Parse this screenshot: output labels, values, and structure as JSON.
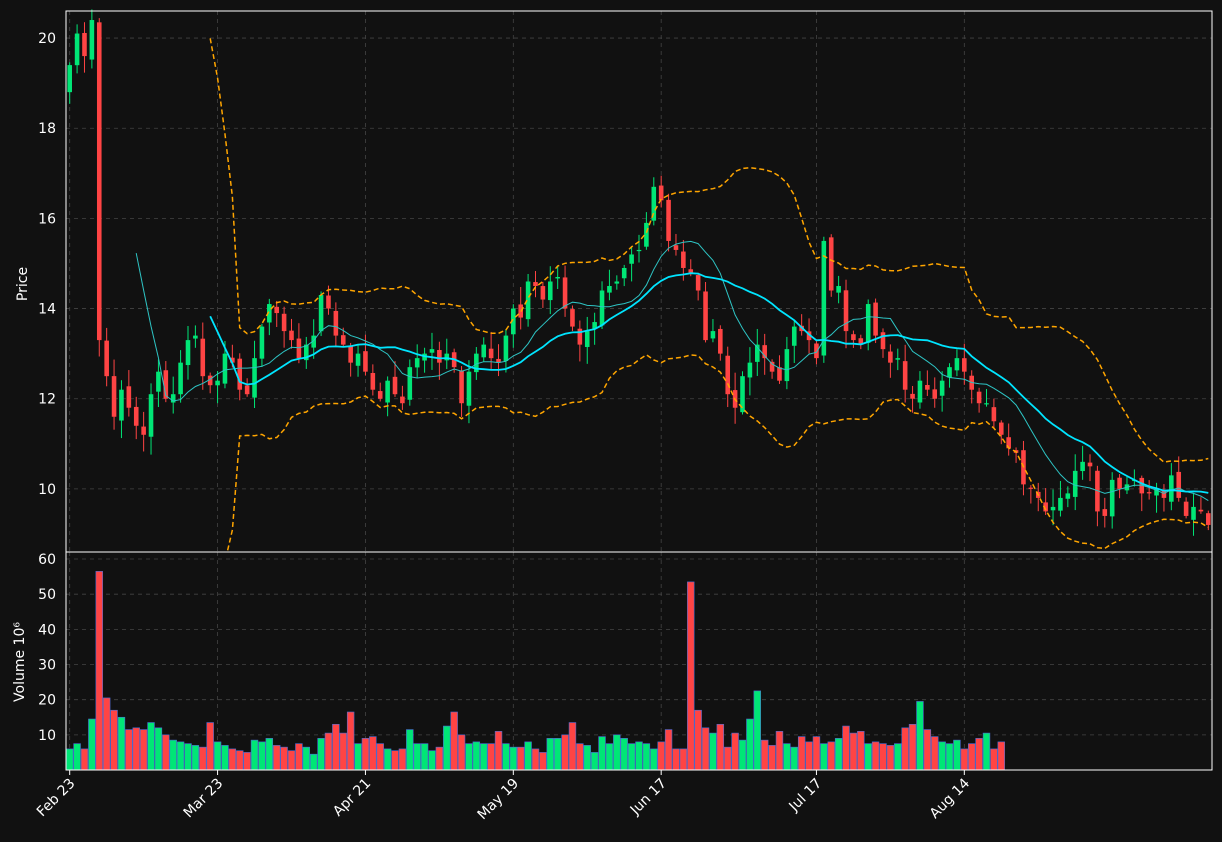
{
  "chart_data": [
    {
      "type": "candlestick",
      "ylabel": "Price",
      "ylim": [
        8.6,
        20.6
      ],
      "y_ticks": [
        10,
        12,
        14,
        16,
        18,
        20
      ],
      "grid": true,
      "colors": {
        "up": "#00e676",
        "down": "#ff4444",
        "ma_fast": "#2ec4c4",
        "ma_slow": "#00e5ff",
        "bands": "#ffa500",
        "background": "#111111",
        "grid": "#444444"
      },
      "x_ticks": [
        "Feb 23",
        "Mar 23",
        "Apr 21",
        "May 19",
        "Jun 17",
        "Jul 17",
        "Aug 14"
      ],
      "closes": [
        19.4,
        20.1,
        19.6,
        20.4,
        13.3,
        12.5,
        11.6,
        12.2,
        11.8,
        11.4,
        11.2,
        12.1,
        12.6,
        12.0,
        12.1,
        12.8,
        13.3,
        13.4,
        12.5,
        12.3,
        12.4,
        13.0,
        12.8,
        12.2,
        12.1,
        12.9,
        13.6,
        14.1,
        13.9,
        13.5,
        13.3,
        12.9,
        13.2,
        13.4,
        14.3,
        14.0,
        13.4,
        13.2,
        12.8,
        13.0,
        12.6,
        12.2,
        12.0,
        12.4,
        12.1,
        11.9,
        12.7,
        12.9,
        13.0,
        13.1,
        12.8,
        13.0,
        12.7,
        11.9,
        12.6,
        13.0,
        13.2,
        12.9,
        12.8,
        13.4,
        14.0,
        13.8,
        14.6,
        14.5,
        14.2,
        14.6,
        14.7,
        14.0,
        13.6,
        13.2,
        13.5,
        13.7,
        14.4,
        14.5,
        14.6,
        14.9,
        15.2,
        15.3,
        15.9,
        16.7,
        16.4,
        15.5,
        15.3,
        14.9,
        14.8,
        14.4,
        13.3,
        13.5,
        13.0,
        12.1,
        11.8,
        12.5,
        12.8,
        13.2,
        12.9,
        12.6,
        12.4,
        13.1,
        13.6,
        13.5,
        13.3,
        12.9,
        15.5,
        14.4,
        14.5,
        13.5,
        13.3,
        13.2,
        14.1,
        13.4,
        13.1,
        12.8,
        12.9,
        12.2,
        12.0,
        12.4,
        12.2,
        12.0,
        12.4,
        12.7,
        12.9,
        12.6,
        12.2,
        11.9,
        11.9,
        11.5,
        11.2,
        10.9,
        10.8,
        10.1,
        10.0,
        9.8,
        9.5,
        9.6,
        9.8,
        9.9,
        10.4,
        10.6,
        10.5,
        9.5,
        9.4,
        10.2,
        10.0,
        10.1,
        10.2,
        9.9,
        9.9,
        10.0,
        9.8,
        10.3,
        9.8,
        9.4,
        9.6,
        9.5,
        9.2
      ],
      "volumes": [
        6.0,
        7.5,
        6.0,
        14.5,
        56.5,
        20.5,
        17.0,
        15.0,
        11.5,
        12.0,
        11.5,
        13.5,
        12.0,
        10.0,
        8.5,
        8.0,
        7.5,
        7.0,
        6.5,
        13.5,
        8.0,
        7.0,
        6.0,
        5.5,
        5.0,
        8.5,
        8.0,
        9.0,
        7.0,
        6.5,
        5.5,
        7.5,
        6.5,
        4.5,
        9.0,
        10.5,
        13.0,
        10.5,
        16.5,
        7.5,
        9.0,
        9.5,
        7.5,
        6.0,
        5.5,
        6.0,
        11.5,
        7.5,
        7.5,
        5.5,
        6.5,
        12.5,
        16.5,
        10.0,
        7.5,
        8.0,
        7.5,
        7.5,
        11.0,
        7.5,
        6.5,
        6.5,
        8.0,
        6.0,
        5.0,
        9.0,
        9.0,
        10.0,
        13.5,
        7.5,
        7.0,
        5.0,
        9.5,
        7.5,
        10.0,
        9.0,
        7.5,
        8.0,
        7.5,
        6.0,
        8.0,
        11.5,
        6.0,
        6.0,
        53.5,
        17.0,
        12.0,
        10.5,
        13.0,
        6.5,
        10.5,
        8.5,
        14.5,
        22.5,
        8.5,
        7.0,
        11.0,
        7.5,
        6.5,
        9.5,
        8.0,
        9.5,
        7.5,
        8.0,
        9.0,
        12.5,
        10.5,
        11.0,
        7.5,
        8.0,
        7.5,
        7.0,
        7.5,
        12.0,
        13.0,
        19.5,
        11.5,
        9.5,
        8.0,
        7.5,
        8.5,
        6.0,
        7.5,
        9.0,
        10.5,
        6.0,
        8.0
      ]
    },
    {
      "type": "bar",
      "ylabel": "Volume  10⁶",
      "ylim": [
        0,
        62
      ],
      "y_ticks": [
        10,
        20,
        30,
        40,
        50,
        60
      ]
    }
  ]
}
